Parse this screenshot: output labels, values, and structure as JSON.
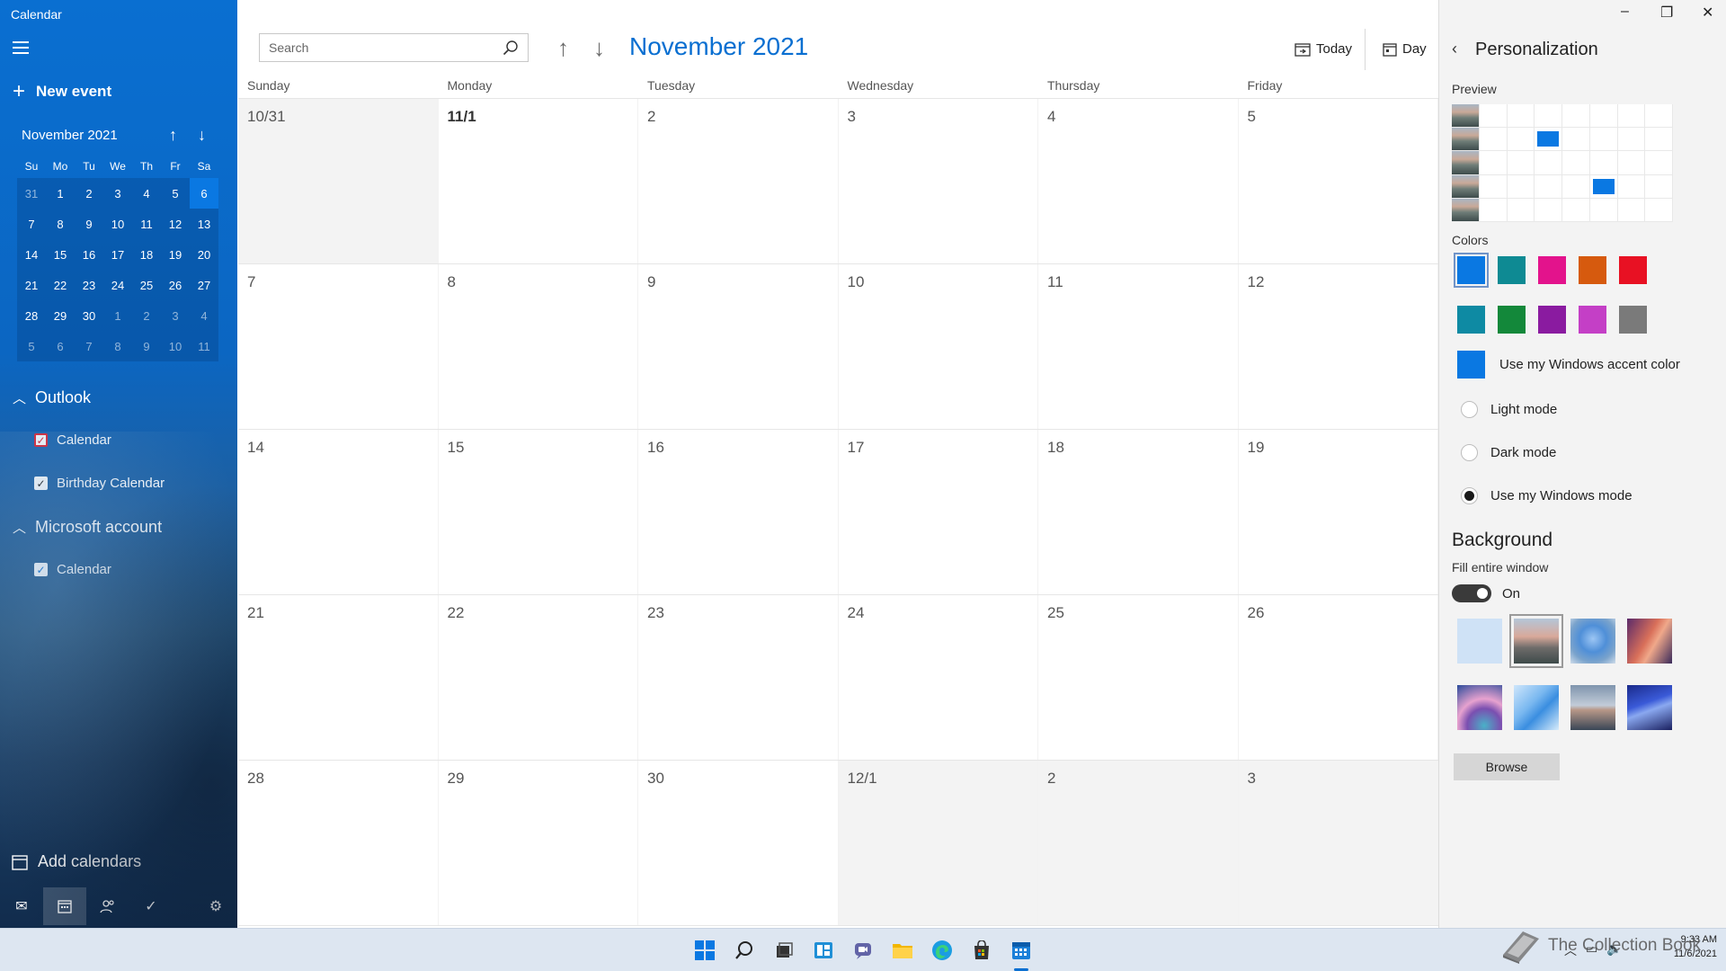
{
  "app": {
    "title": "Calendar"
  },
  "sidebar": {
    "new_event": "New event",
    "mini_calendar": {
      "month_label": "November 2021",
      "dow": [
        "Su",
        "Mo",
        "Tu",
        "We",
        "Th",
        "Fr",
        "Sa"
      ],
      "weeks": [
        [
          "31",
          "1",
          "2",
          "3",
          "4",
          "5",
          "6"
        ],
        [
          "7",
          "8",
          "9",
          "10",
          "11",
          "12",
          "13"
        ],
        [
          "14",
          "15",
          "16",
          "17",
          "18",
          "19",
          "20"
        ],
        [
          "21",
          "22",
          "23",
          "24",
          "25",
          "26",
          "27"
        ],
        [
          "28",
          "29",
          "30",
          "1",
          "2",
          "3",
          "4"
        ],
        [
          "5",
          "6",
          "7",
          "8",
          "9",
          "10",
          "11"
        ]
      ]
    },
    "groups": {
      "outlook": {
        "label": "Outlook",
        "items": [
          "Calendar",
          "Birthday Calendar"
        ]
      },
      "microsoft": {
        "label": "Microsoft account",
        "items": [
          "Calendar"
        ]
      }
    },
    "add_calendars": "Add calendars"
  },
  "toolbar": {
    "search_placeholder": "Search",
    "month_title": "November 2021",
    "today": "Today",
    "day": "Day"
  },
  "calendar": {
    "dow": [
      "Sunday",
      "Monday",
      "Tuesday",
      "Wednesday",
      "Thursday",
      "Friday"
    ],
    "weeks": [
      [
        "10/31",
        "11/1",
        "2",
        "3",
        "4",
        "5"
      ],
      [
        "7",
        "8",
        "9",
        "10",
        "11",
        "12"
      ],
      [
        "14",
        "15",
        "16",
        "17",
        "18",
        "19"
      ],
      [
        "21",
        "22",
        "23",
        "24",
        "25",
        "26"
      ],
      [
        "28",
        "29",
        "30",
        "12/1",
        "2",
        "3"
      ]
    ]
  },
  "personalization": {
    "title": "Personalization",
    "preview_label": "Preview",
    "colors_label": "Colors",
    "colors": [
      "#0a78e2",
      "#0e8a93",
      "#e3138c",
      "#d65a0e",
      "#e81123",
      "#0e8aa3",
      "#13883a",
      "#8a1ba0",
      "#c43fc6",
      "#7a7a7a"
    ],
    "accent_label": "Use my Windows accent color",
    "accent_color": "#0a78e2",
    "modes": [
      "Light mode",
      "Dark mode",
      "Use my Windows mode"
    ],
    "selected_mode": "Use my Windows mode",
    "background_title": "Background",
    "fill_label": "Fill entire window",
    "toggle_state": "On",
    "browse": "Browse"
  },
  "tray": {
    "time": "9:33 AM",
    "date": "11/6/2021"
  },
  "watermark": "The Collection Book"
}
